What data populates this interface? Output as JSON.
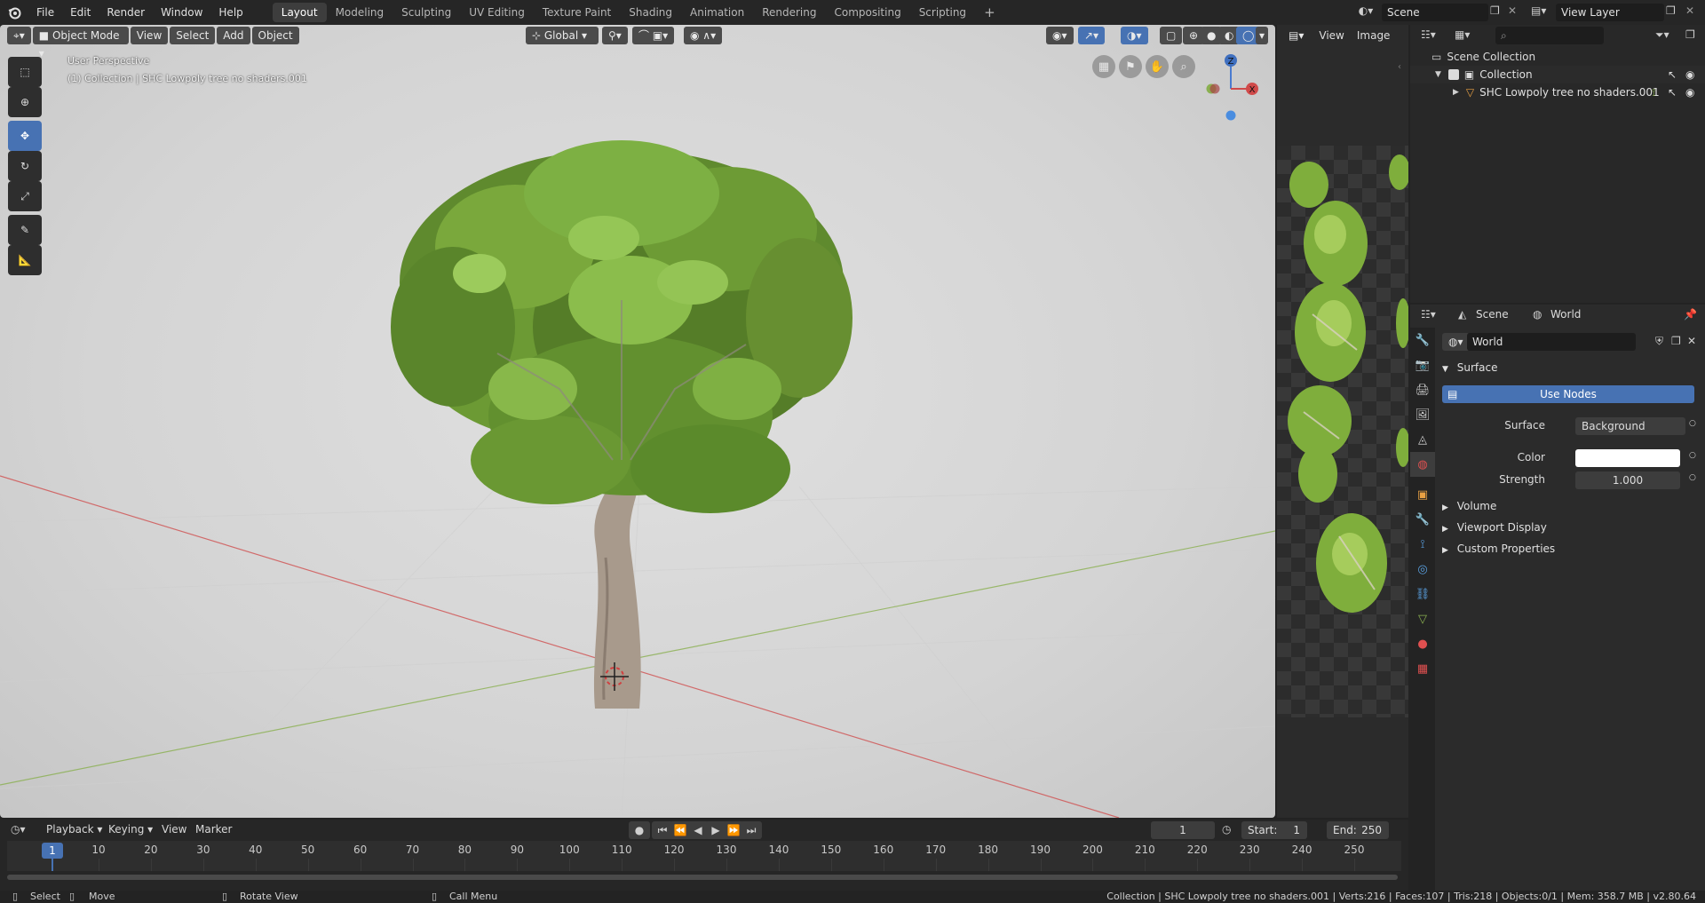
{
  "topbar": {
    "menus": [
      "File",
      "Edit",
      "Render",
      "Window",
      "Help"
    ],
    "workspaces": [
      "Layout",
      "Modeling",
      "Sculpting",
      "UV Editing",
      "Texture Paint",
      "Shading",
      "Animation",
      "Rendering",
      "Compositing",
      "Scripting"
    ],
    "active_workspace": "Layout",
    "add_tab": "+",
    "scene_name": "Scene",
    "view_layer": "View Layer"
  },
  "viewport": {
    "mode": "Object Mode",
    "menus": [
      "View",
      "Select",
      "Add",
      "Object"
    ],
    "transform_orientation": "Global",
    "perspective_label": "User Perspective",
    "collection_label": "(1) Collection | SHC Lowpoly tree no shaders.001",
    "gizmo": {
      "z": "Z",
      "x": "X"
    }
  },
  "image_editor": {
    "menus": [
      "View",
      "Image"
    ]
  },
  "outliner": {
    "root": "Scene Collection",
    "collection": "Collection",
    "object": "SHC Lowpoly tree no shaders.001"
  },
  "properties": {
    "breadcrumb_scene": "Scene",
    "breadcrumb_world": "World",
    "world_name": "World",
    "surface_panel": "Surface",
    "use_nodes": "Use Nodes",
    "surface_label": "Surface",
    "surface_value": "Background",
    "color_label": "Color",
    "color_value": "#ffffff",
    "strength_label": "Strength",
    "strength_value": "1.000",
    "collapsed_panels": [
      "Volume",
      "Viewport Display",
      "Custom Properties"
    ]
  },
  "timeline": {
    "menus": [
      "Playback",
      "Keying",
      "View",
      "Marker"
    ],
    "current_frame": "1",
    "start_label": "Start:",
    "start_value": "1",
    "end_label": "End:",
    "end_value": "250",
    "ticks": [
      "1",
      "10",
      "20",
      "30",
      "40",
      "50",
      "60",
      "70",
      "80",
      "90",
      "100",
      "110",
      "120",
      "130",
      "140",
      "150",
      "160",
      "170",
      "180",
      "190",
      "200",
      "210",
      "220",
      "230",
      "240",
      "250"
    ]
  },
  "statusbar": {
    "select": "Select",
    "move": "Move",
    "rotate": "Rotate View",
    "menu": "Call Menu",
    "stats": "Collection | SHC Lowpoly tree no shaders.001 | Verts:216 | Faces:107 | Tris:218 | Objects:0/1 | Mem: 358.7 MB | v2.80.64"
  },
  "colors": {
    "accent": "#4772b3",
    "panel": "#2b2b2b",
    "header": "#262626",
    "axis_x": "#d05050",
    "axis_y": "#8ab050"
  }
}
